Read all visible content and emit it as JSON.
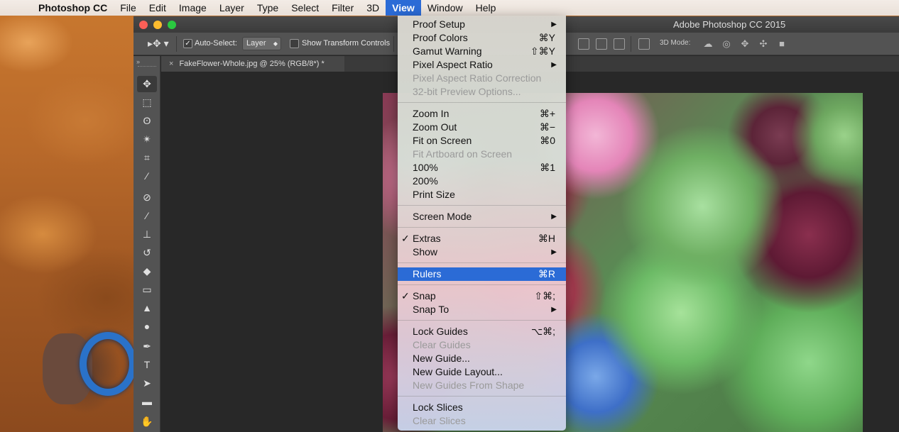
{
  "menubar": {
    "app_name": "Photoshop CC",
    "items": [
      "File",
      "Edit",
      "Image",
      "Layer",
      "Type",
      "Select",
      "Filter",
      "3D",
      "View",
      "Window",
      "Help"
    ],
    "active": "View"
  },
  "window": {
    "title": "Adobe Photoshop CC 2015"
  },
  "options_bar": {
    "auto_select_label": "Auto-Select:",
    "auto_select_value": "Layer",
    "show_transform_label": "Show Transform Controls",
    "mode_3d_label": "3D Mode:"
  },
  "document_tab": {
    "label": "FakeFlower-Whole.jpg @ 25% (RGB/8*) *",
    "close": "×"
  },
  "view_menu": {
    "sections": [
      [
        {
          "label": "Proof Setup",
          "shortcut": "",
          "submenu": true,
          "disabled": false
        },
        {
          "label": "Proof Colors",
          "shortcut": "⌘Y",
          "submenu": false,
          "disabled": false
        },
        {
          "label": "Gamut Warning",
          "shortcut": "⇧⌘Y",
          "submenu": false,
          "disabled": false
        },
        {
          "label": "Pixel Aspect Ratio",
          "shortcut": "",
          "submenu": true,
          "disabled": false
        },
        {
          "label": "Pixel Aspect Ratio Correction",
          "shortcut": "",
          "submenu": false,
          "disabled": true
        },
        {
          "label": "32-bit Preview Options...",
          "shortcut": "",
          "submenu": false,
          "disabled": true
        }
      ],
      [
        {
          "label": "Zoom In",
          "shortcut": "⌘+",
          "submenu": false,
          "disabled": false
        },
        {
          "label": "Zoom Out",
          "shortcut": "⌘−",
          "submenu": false,
          "disabled": false
        },
        {
          "label": "Fit on Screen",
          "shortcut": "⌘0",
          "submenu": false,
          "disabled": false
        },
        {
          "label": "Fit Artboard on Screen",
          "shortcut": "",
          "submenu": false,
          "disabled": true
        },
        {
          "label": "100%",
          "shortcut": "⌘1",
          "submenu": false,
          "disabled": false
        },
        {
          "label": "200%",
          "shortcut": "",
          "submenu": false,
          "disabled": false
        },
        {
          "label": "Print Size",
          "shortcut": "",
          "submenu": false,
          "disabled": false
        }
      ],
      [
        {
          "label": "Screen Mode",
          "shortcut": "",
          "submenu": true,
          "disabled": false
        }
      ],
      [
        {
          "label": "Extras",
          "shortcut": "⌘H",
          "submenu": false,
          "disabled": false,
          "checked": true
        },
        {
          "label": "Show",
          "shortcut": "",
          "submenu": true,
          "disabled": false
        }
      ],
      [
        {
          "label": "Rulers",
          "shortcut": "⌘R",
          "submenu": false,
          "disabled": false,
          "highlighted": true
        }
      ],
      [
        {
          "label": "Snap",
          "shortcut": "⇧⌘;",
          "submenu": false,
          "disabled": false,
          "checked": true
        },
        {
          "label": "Snap To",
          "shortcut": "",
          "submenu": true,
          "disabled": false
        }
      ],
      [
        {
          "label": "Lock Guides",
          "shortcut": "⌥⌘;",
          "submenu": false,
          "disabled": false
        },
        {
          "label": "Clear Guides",
          "shortcut": "",
          "submenu": false,
          "disabled": true
        },
        {
          "label": "New Guide...",
          "shortcut": "",
          "submenu": false,
          "disabled": false
        },
        {
          "label": "New Guide Layout...",
          "shortcut": "",
          "submenu": false,
          "disabled": false
        },
        {
          "label": "New Guides From Shape",
          "shortcut": "",
          "submenu": false,
          "disabled": true
        }
      ],
      [
        {
          "label": "Lock Slices",
          "shortcut": "",
          "submenu": false,
          "disabled": false
        },
        {
          "label": "Clear Slices",
          "shortcut": "",
          "submenu": false,
          "disabled": true
        }
      ]
    ]
  },
  "tools": [
    "move-tool-icon",
    "marquee-tool-icon",
    "lasso-tool-icon",
    "magic-wand-tool-icon",
    "crop-tool-icon",
    "eyedropper-tool-icon",
    "healing-brush-tool-icon",
    "brush-tool-icon",
    "clone-stamp-tool-icon",
    "history-brush-tool-icon",
    "eraser-tool-icon",
    "gradient-tool-icon",
    "sharpen-tool-icon",
    "dodge-tool-icon",
    "pen-tool-icon",
    "type-tool-icon",
    "path-selection-tool-icon",
    "rectangle-tool-icon",
    "hand-tool-icon"
  ],
  "colors": {
    "menubar_highlight": "#2b6bd6",
    "ps_panel": "#535353",
    "ps_canvas": "#282828"
  }
}
